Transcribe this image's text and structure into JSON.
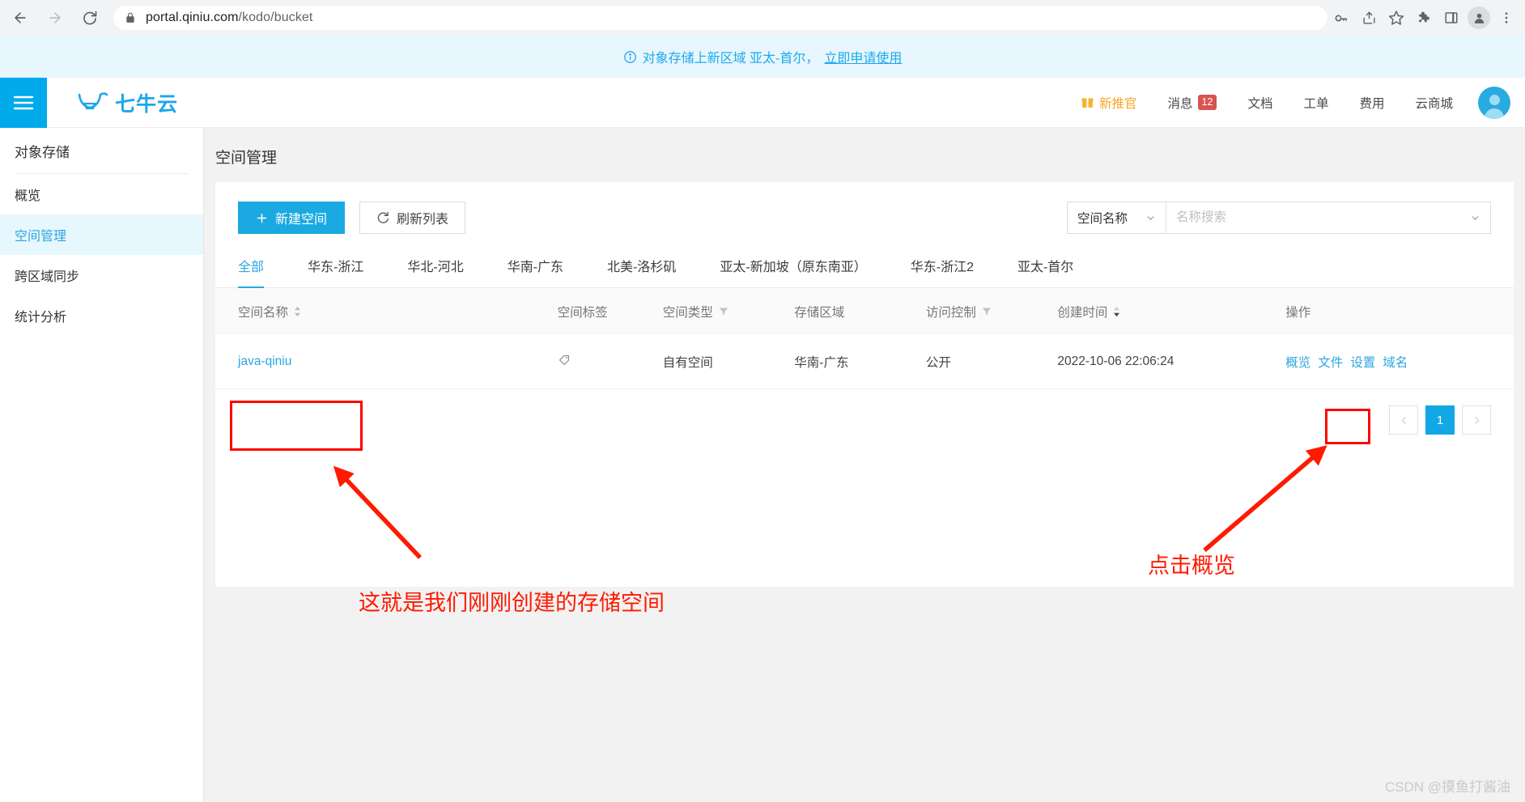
{
  "browser": {
    "url_main": "portal.qiniu.com",
    "url_path": "/kodo/bucket",
    "icons": {
      "back": "back-arrow-icon",
      "forward": "forward-arrow-icon",
      "reload": "reload-icon",
      "lock": "lock-icon",
      "password": "key-icon",
      "share": "share-icon",
      "bookmark": "star-icon",
      "extensions": "puzzle-icon",
      "sidepanel": "side-panel-icon",
      "profile": "profile-avatar-icon",
      "menu": "kebab-menu-icon"
    }
  },
  "notice": {
    "icon": "info-circle-icon",
    "text": "对象存储上新区域 亚太-首尔，",
    "link": "立即申请使用"
  },
  "header": {
    "menu_icon": "hamburger-menu-icon",
    "brand": "七牛云",
    "brand_logo_icon": "qiniu-bull-logo-icon",
    "nav": [
      {
        "label": "新推官",
        "icon": "gift-icon",
        "badge": null
      },
      {
        "label": "消息",
        "icon": null,
        "badge": "12"
      },
      {
        "label": "文档",
        "icon": null,
        "badge": null
      },
      {
        "label": "工单",
        "icon": null,
        "badge": null
      },
      {
        "label": "费用",
        "icon": null,
        "badge": null
      },
      {
        "label": "云商城",
        "icon": null,
        "badge": null
      }
    ],
    "avatar_icon": "user-avatar-icon"
  },
  "sidebar": {
    "title": "对象存储",
    "items": [
      {
        "label": "概览",
        "active": false
      },
      {
        "label": "空间管理",
        "active": true
      },
      {
        "label": "跨区域同步",
        "active": false
      },
      {
        "label": "统计分析",
        "active": false
      }
    ]
  },
  "main": {
    "page_title": "空间管理",
    "toolbar": {
      "create_label": "新建空间",
      "create_icon": "plus-icon",
      "refresh_label": "刷新列表",
      "refresh_icon": "refresh-icon"
    },
    "search": {
      "select_value": "空间名称",
      "select_icon": "chevron-down-icon",
      "input_value": "",
      "placeholder": "名称搜索",
      "input_icon": "chevron-down-icon"
    },
    "region_tabs": [
      {
        "label": "全部",
        "active": true
      },
      {
        "label": "华东-浙江",
        "active": false
      },
      {
        "label": "华北-河北",
        "active": false
      },
      {
        "label": "华南-广东",
        "active": false
      },
      {
        "label": "北美-洛杉矶",
        "active": false
      },
      {
        "label": "亚太-新加坡（原东南亚）",
        "active": false
      },
      {
        "label": "华东-浙江2",
        "active": false
      },
      {
        "label": "亚太-首尔",
        "active": false
      }
    ],
    "table": {
      "columns": [
        {
          "label": "空间名称",
          "icon": "sort-icon"
        },
        {
          "label": "空间标签",
          "icon": null
        },
        {
          "label": "空间类型",
          "icon": "filter-icon"
        },
        {
          "label": "存储区域",
          "icon": null
        },
        {
          "label": "访问控制",
          "icon": "filter-icon"
        },
        {
          "label": "创建时间",
          "icon": "sort-icon"
        },
        {
          "label": "操作",
          "icon": null
        }
      ],
      "rows": [
        {
          "name": "java-qiniu",
          "tag_icon": "tag-icon",
          "type": "自有空间",
          "region": "华南-广东",
          "acl": "公开",
          "created": "2022-10-06 22:06:24",
          "actions": [
            "概览",
            "文件",
            "设置",
            "域名"
          ]
        }
      ]
    },
    "pagination": {
      "prev_icon": "chevron-left-icon",
      "next_icon": "chevron-right-icon",
      "current_page": "1"
    }
  },
  "annotations": {
    "note_bucket": "这就是我们刚刚创建的存储空间",
    "note_overview": "点击概览",
    "accent_color": "#ff1a00"
  },
  "watermark": "CSDN @摸鱼打酱油"
}
